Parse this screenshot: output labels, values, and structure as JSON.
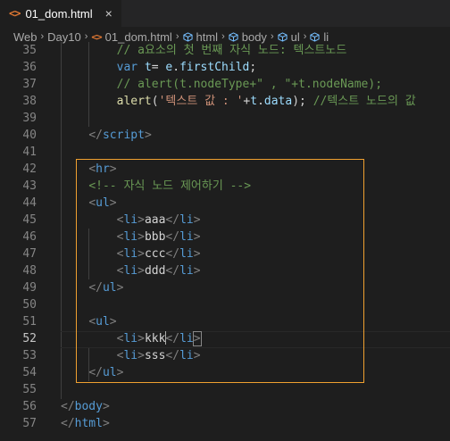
{
  "tab": {
    "icon": "<>",
    "label": "01_dom.html",
    "close": "×"
  },
  "breadcrumb": {
    "items": [
      "Web",
      "Day10",
      "01_dom.html",
      "html",
      "body",
      "ul",
      "li"
    ],
    "separator": "›"
  },
  "editor": {
    "lines": [
      {
        "n": "35",
        "tokens": [
          [
            "    ",
            ""
          ],
          [
            "    ",
            ""
          ],
          [
            "// a요소의 첫 번째 자식 노드: 텍스트노드",
            "t-cmt"
          ]
        ]
      },
      {
        "n": "36",
        "tokens": [
          [
            "        ",
            ""
          ],
          [
            "var",
            "t-kw"
          ],
          [
            " ",
            ""
          ],
          [
            "t",
            "t-var"
          ],
          [
            "= ",
            "t-op"
          ],
          [
            "e",
            "t-var"
          ],
          [
            ".",
            "t-op"
          ],
          [
            "firstChild",
            "t-var"
          ],
          [
            ";",
            "t-op"
          ]
        ]
      },
      {
        "n": "37",
        "tokens": [
          [
            "        ",
            ""
          ],
          [
            "// alert(t.nodeType+\" , \"+t.nodeName);",
            "t-cmt"
          ]
        ]
      },
      {
        "n": "38",
        "tokens": [
          [
            "        ",
            ""
          ],
          [
            "alert",
            "t-fn"
          ],
          [
            "(",
            "t-op"
          ],
          [
            "'텍스트 값 : '",
            "t-str"
          ],
          [
            "+",
            "t-op"
          ],
          [
            "t",
            "t-var"
          ],
          [
            ".",
            "t-op"
          ],
          [
            "data",
            "t-var"
          ],
          [
            ");",
            "t-op"
          ],
          [
            " ",
            ""
          ],
          [
            "//텍스트 노드의 값",
            "t-cmt"
          ]
        ]
      },
      {
        "n": "39",
        "tokens": []
      },
      {
        "n": "40",
        "tokens": [
          [
            "    ",
            ""
          ],
          [
            "</",
            "t-br"
          ],
          [
            "script",
            "t-tag"
          ],
          [
            ">",
            "t-br"
          ]
        ]
      },
      {
        "n": "41",
        "tokens": []
      },
      {
        "n": "42",
        "tokens": [
          [
            "    ",
            ""
          ],
          [
            "<",
            "t-br"
          ],
          [
            "hr",
            "t-tag"
          ],
          [
            ">",
            "t-br"
          ]
        ]
      },
      {
        "n": "43",
        "tokens": [
          [
            "    ",
            ""
          ],
          [
            "<!-- 자식 노드 제어하기 -->",
            "t-cmt"
          ]
        ]
      },
      {
        "n": "44",
        "tokens": [
          [
            "    ",
            ""
          ],
          [
            "<",
            "t-br"
          ],
          [
            "ul",
            "t-tag"
          ],
          [
            ">",
            "t-br"
          ]
        ]
      },
      {
        "n": "45",
        "tokens": [
          [
            "        ",
            ""
          ],
          [
            "<",
            "t-br"
          ],
          [
            "li",
            "t-tag"
          ],
          [
            ">",
            "t-br"
          ],
          [
            "aaa",
            "t-txt"
          ],
          [
            "</",
            "t-br"
          ],
          [
            "li",
            "t-tag"
          ],
          [
            ">",
            "t-br"
          ]
        ]
      },
      {
        "n": "46",
        "tokens": [
          [
            "        ",
            ""
          ],
          [
            "<",
            "t-br"
          ],
          [
            "li",
            "t-tag"
          ],
          [
            ">",
            "t-br"
          ],
          [
            "bbb",
            "t-txt"
          ],
          [
            "</",
            "t-br"
          ],
          [
            "li",
            "t-tag"
          ],
          [
            ">",
            "t-br"
          ]
        ]
      },
      {
        "n": "47",
        "tokens": [
          [
            "        ",
            ""
          ],
          [
            "<",
            "t-br"
          ],
          [
            "li",
            "t-tag"
          ],
          [
            ">",
            "t-br"
          ],
          [
            "ccc",
            "t-txt"
          ],
          [
            "</",
            "t-br"
          ],
          [
            "li",
            "t-tag"
          ],
          [
            ">",
            "t-br"
          ]
        ]
      },
      {
        "n": "48",
        "tokens": [
          [
            "        ",
            ""
          ],
          [
            "<",
            "t-br"
          ],
          [
            "li",
            "t-tag"
          ],
          [
            ">",
            "t-br"
          ],
          [
            "ddd",
            "t-txt"
          ],
          [
            "</",
            "t-br"
          ],
          [
            "li",
            "t-tag"
          ],
          [
            ">",
            "t-br"
          ]
        ]
      },
      {
        "n": "49",
        "tokens": [
          [
            "    ",
            ""
          ],
          [
            "</",
            "t-br"
          ],
          [
            "ul",
            "t-tag"
          ],
          [
            ">",
            "t-br"
          ]
        ]
      },
      {
        "n": "50",
        "tokens": []
      },
      {
        "n": "51",
        "tokens": [
          [
            "    ",
            ""
          ],
          [
            "<",
            "t-br"
          ],
          [
            "ul",
            "t-tag"
          ],
          [
            ">",
            "t-br"
          ]
        ]
      },
      {
        "n": "52",
        "current": true,
        "tokens": [
          [
            "        ",
            ""
          ],
          [
            "<",
            "t-br"
          ],
          [
            "li",
            "t-tag"
          ],
          [
            ">",
            "t-br"
          ],
          [
            "kkk",
            "t-txt"
          ],
          [
            "CURSOR",
            ""
          ],
          [
            "</",
            "t-br"
          ],
          [
            "li",
            "t-tag"
          ],
          [
            ">",
            "t-br"
          ]
        ]
      },
      {
        "n": "53",
        "tokens": [
          [
            "        ",
            ""
          ],
          [
            "<",
            "t-br"
          ],
          [
            "li",
            "t-tag"
          ],
          [
            ">",
            "t-br"
          ],
          [
            "sss",
            "t-txt"
          ],
          [
            "</",
            "t-br"
          ],
          [
            "li",
            "t-tag"
          ],
          [
            ">",
            "t-br"
          ]
        ]
      },
      {
        "n": "54",
        "tokens": [
          [
            "    ",
            ""
          ],
          [
            "</",
            "t-br"
          ],
          [
            "ul",
            "t-tag"
          ],
          [
            ">",
            "t-br"
          ]
        ]
      },
      {
        "n": "55",
        "tokens": []
      },
      {
        "n": "56",
        "tokens": [
          [
            "",
            ""
          ],
          [
            "</",
            "t-br"
          ],
          [
            "body",
            "t-tag"
          ],
          [
            ">",
            "t-br"
          ]
        ]
      },
      {
        "n": "57",
        "tokens": [
          [
            "",
            ""
          ],
          [
            "</",
            "t-br"
          ],
          [
            "html",
            "t-tag"
          ],
          [
            ">",
            "t-br"
          ]
        ]
      }
    ]
  },
  "colors": {
    "background": "#1e1e1e",
    "selection_border": "#f0a030",
    "tag": "#569cd6",
    "comment": "#6a9955",
    "string": "#ce9178",
    "function": "#dcdcaa",
    "variable": "#9cdcfe"
  }
}
